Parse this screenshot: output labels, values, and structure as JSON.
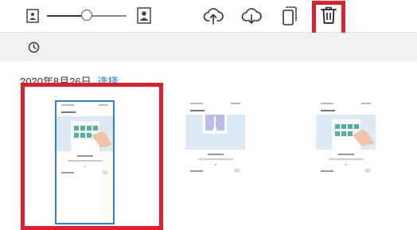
{
  "toolbar": {
    "icons": {
      "small_thumb": "small-thumbnail-icon",
      "large_thumb": "large-thumbnail-icon",
      "upload": "cloud-upload-icon",
      "download": "cloud-download-icon",
      "copy": "copy-icon",
      "delete": "trash-icon"
    },
    "zoom_slider": {
      "value_fraction": 0.5
    }
  },
  "subbar": {
    "icon": "clock-icon"
  },
  "group": {
    "date": "2020年8月26日",
    "select_label": "选择"
  },
  "thumbnails": [
    {
      "selected": true,
      "illustration": "grid-with-hand"
    },
    {
      "selected": false,
      "illustration": "phone-swipe-down"
    },
    {
      "selected": false,
      "illustration": "grid-with-hand"
    }
  ],
  "colors": {
    "accent": "#1a73e8",
    "highlight": "#e0202a",
    "selection_border": "#2b7de9",
    "illustration_bg": "#dbeaf4",
    "tile_green": "#4fb59a"
  }
}
